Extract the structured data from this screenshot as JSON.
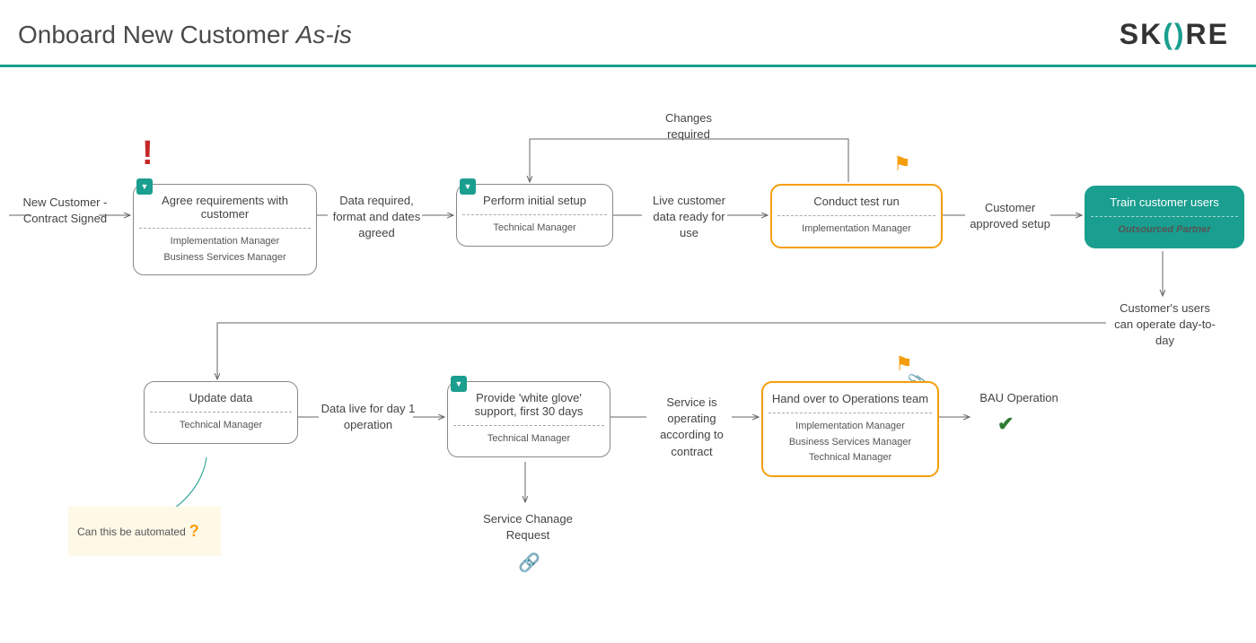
{
  "page": {
    "title_main": "Onboard New Customer ",
    "title_italic": "As-is",
    "logo": {
      "p1": "SK",
      "paren_open": "(",
      "paren_close": ")",
      "p2": "RE"
    }
  },
  "labels": {
    "start": "New Customer - Contract Signed",
    "data_required": "Data required, format and dates agreed",
    "live_data": "Live customer data ready for use",
    "changes_required": "Changes required",
    "customer_approved": "Customer approved setup",
    "users_operate": "Customer's users can operate day-to-day",
    "data_live": "Data live for day 1 operation",
    "service_operating": "Service is operating according to contract",
    "bau": "BAU Operation",
    "service_change": "Service Chanage Request"
  },
  "boxes": {
    "agree": {
      "title": "Agree requirements with customer",
      "roles": [
        "Implementation Manager",
        "Business Services Manager"
      ]
    },
    "perform": {
      "title": "Perform initial setup",
      "roles": [
        "Technical Manager"
      ]
    },
    "conduct": {
      "title": "Conduct test run",
      "roles": [
        "Implementation Manager"
      ]
    },
    "train": {
      "title": "Train customer users",
      "roles": [
        "Outsourced Partner"
      ]
    },
    "update": {
      "title": "Update data",
      "roles": [
        "Technical Manager"
      ]
    },
    "whiteglove": {
      "title": "Provide 'white glove' support, first 30 days",
      "roles": [
        "Technical Manager"
      ]
    },
    "handover": {
      "title": "Hand over to Operations team",
      "roles": [
        "Implementation Manager",
        "Business Services Manager",
        "Technical Manager"
      ]
    }
  },
  "sticky": {
    "text": "Can this be automated"
  }
}
